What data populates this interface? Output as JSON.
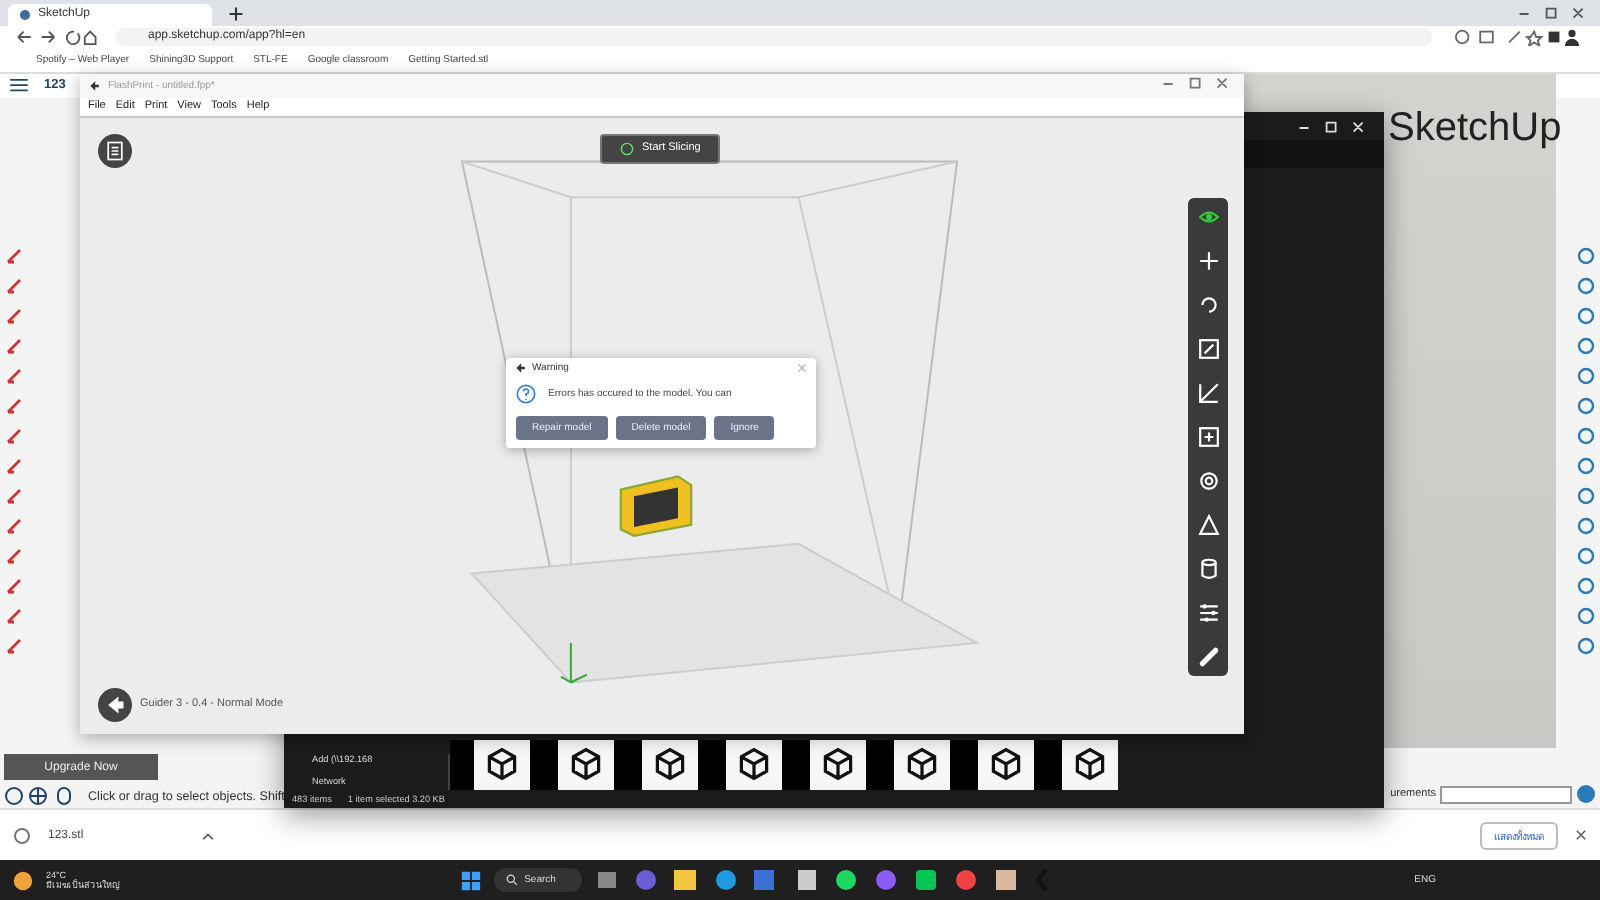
{
  "browser": {
    "tab_title": "SketchUp",
    "url": "app.sketchup.com/app?hl=en",
    "bookmarks": [
      "Spotify – Web Player",
      "Shining3D Support",
      "STL-FE",
      "Google classroom",
      "Getting Started.stl"
    ]
  },
  "sketchup": {
    "file_name": "123",
    "brand": "SketchUp",
    "upgrade_button": "Upgrade Now",
    "status_text": "Click or drag to select objects. Shift",
    "measurements_label": "urements"
  },
  "flashprint": {
    "title": "FlashPrint - untitled.fpp*",
    "menu": [
      "File",
      "Edit",
      "Print",
      "View",
      "Tools",
      "Help"
    ],
    "start_button": "Start Slicing",
    "printer_status": "Guider 3 - 0.4 - Normal Mode",
    "dialog": {
      "title": "Warning",
      "message": "Errors has occured to the model. You can",
      "buttons": [
        "Repair model",
        "Delete model",
        "Ignore"
      ]
    }
  },
  "explorer": {
    "tree": [
      "Add (\\\\192.168",
      "Network"
    ],
    "status": [
      "483 items",
      "1 item selected  3.20 KB"
    ]
  },
  "downloads": {
    "file": "123.stl",
    "show_all": "แสดงทั้งหมด"
  },
  "taskbar": {
    "temperature": "24°C",
    "weather": "มีเมฆเป็นส่วนใหญ่",
    "search": "Search",
    "language": "ENG"
  }
}
